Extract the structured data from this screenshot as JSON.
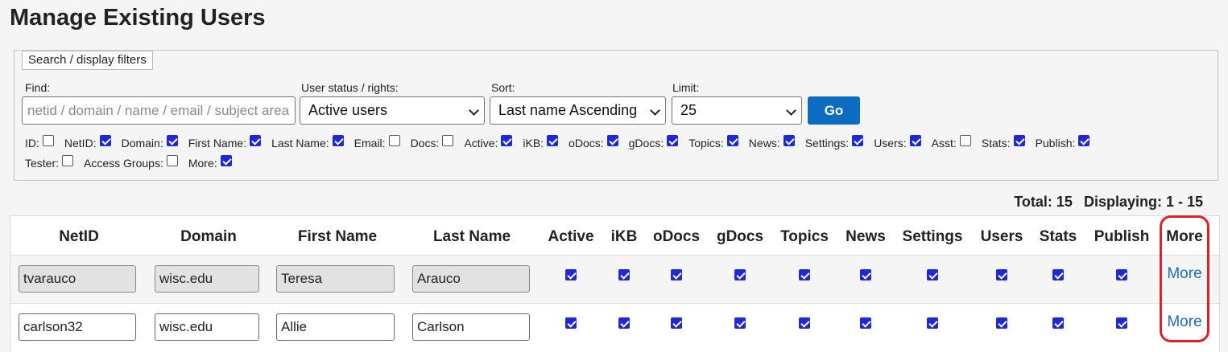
{
  "page_title": "Manage Existing Users",
  "filters": {
    "legend": "Search / display filters",
    "find_label": "Find:",
    "find_placeholder": "netid / domain / name / email / subject area",
    "status_label": "User status / rights:",
    "status_value": "Active users",
    "sort_label": "Sort:",
    "sort_value": "Last name Ascending",
    "limit_label": "Limit:",
    "limit_value": "25",
    "go_label": "Go",
    "checkboxes_row1": [
      {
        "label": "ID:",
        "checked": false
      },
      {
        "label": "NetID:",
        "checked": true
      },
      {
        "label": "Domain:",
        "checked": true
      },
      {
        "label": "First Name:",
        "checked": true
      },
      {
        "label": "Last Name:",
        "checked": true
      },
      {
        "label": "Email:",
        "checked": false
      },
      {
        "label": "Docs:",
        "checked": false
      },
      {
        "label": "Active:",
        "checked": true
      },
      {
        "label": "iKB:",
        "checked": true
      },
      {
        "label": "oDocs:",
        "checked": true
      },
      {
        "label": "gDocs:",
        "checked": true
      },
      {
        "label": "Topics:",
        "checked": true
      },
      {
        "label": "News:",
        "checked": true
      },
      {
        "label": "Settings:",
        "checked": true
      },
      {
        "label": "Users:",
        "checked": true
      },
      {
        "label": "Asst:",
        "checked": false
      },
      {
        "label": "Stats:",
        "checked": true
      },
      {
        "label": "Publish:",
        "checked": true
      }
    ],
    "checkboxes_row2": [
      {
        "label": "Tester:",
        "checked": false
      },
      {
        "label": "Access Groups:",
        "checked": false
      },
      {
        "label": "More:",
        "checked": true
      }
    ]
  },
  "totals": {
    "total": "Total: 15",
    "displaying": "Displaying: 1 - 15"
  },
  "table": {
    "headers": [
      "NetID",
      "Domain",
      "First Name",
      "Last Name",
      "Active",
      "iKB",
      "oDocs",
      "gDocs",
      "Topics",
      "News",
      "Settings",
      "Users",
      "Stats",
      "Publish",
      "More"
    ],
    "rows": [
      {
        "netid": "tvarauco",
        "domain": "wisc.edu",
        "first": "Teresa",
        "last": "Arauco",
        "more": "More"
      },
      {
        "netid": "carlson32",
        "domain": "wisc.edu",
        "first": "Allie",
        "last": "Carlson",
        "more": "More"
      }
    ]
  },
  "colors": {
    "accent": "#0b6cc2",
    "checkbox": "#1f28d9",
    "link": "#1a6bc2",
    "highlight": "#e3202a"
  }
}
